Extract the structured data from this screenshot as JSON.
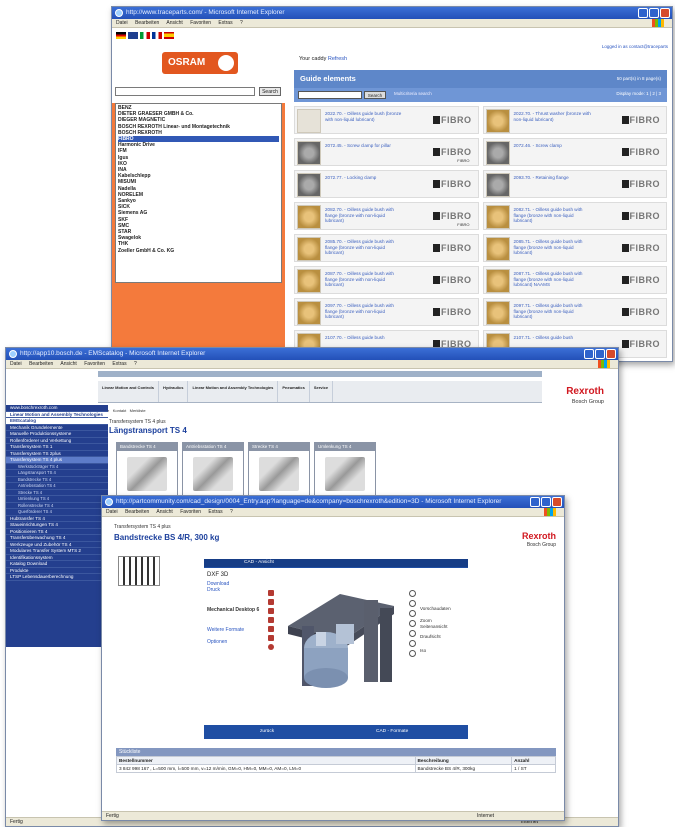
{
  "window1": {
    "title": "http://www.traceparts.com/ - Microsoft Internet Explorer",
    "menu": [
      "Datei",
      "Bearbeiten",
      "Ansicht",
      "Favoriten",
      "Extras",
      "?"
    ],
    "search_button": "Search",
    "logo_text": "OSRAM",
    "manufacturers": [
      "BENZ",
      "DIETER GRAESER GMBH & Co.",
      "DIEGER MAGNETIC",
      "BOSCH REXROTH Linear- und Montagetechnik",
      "BOSCH REXROTH",
      "FIBRO",
      "Harmonic Drive",
      "IFM",
      "Igus",
      "IKO",
      "INA",
      "Kabelschlepp",
      "MISUMI",
      "Nadella",
      "NORELEM",
      "Sankyo",
      "SICK",
      "Siemens AG",
      "SKF",
      "SMC",
      "STAR",
      "Swagelok",
      "THK",
      "Zoeller GmbH & Co. KG"
    ],
    "cart_label": "Your caddy",
    "cart_link": "Refresh",
    "login_text": "Logged in as contact@traceparts",
    "section_title": "Guide elements",
    "hits_text": "50 part(s) in 8 page(s)",
    "search_btn2": "Search",
    "advanced_link": "Multicriteria search",
    "display_text": "Display mode: 1 | 2 | 3",
    "brand_label": "FIBRO",
    "parts": [
      {
        "text": "2022.70. - Oilless guide bush (bronze with non-liquid lubricant)",
        "style": "plain",
        "note": ""
      },
      {
        "text": "2022.70. - Thrust washer (bronze with non-liquid lubricant)",
        "style": "gold",
        "note": ""
      },
      {
        "text": "2072.45. - Screw clamp for pillar",
        "style": "gray",
        "note": "FIBRO"
      },
      {
        "text": "2072.46. - Screw clamp",
        "style": "gray",
        "note": ""
      },
      {
        "text": "2072.77. - Locking clamp",
        "style": "gray",
        "note": ""
      },
      {
        "text": "2093.70. - Retaining flange",
        "style": "gray",
        "note": ""
      },
      {
        "text": "2082.70. - Oilless guide bush with flange (bronze with non-liquid lubricant)",
        "style": "gold",
        "note": "FIBRO"
      },
      {
        "text": "2082.71. - Oilless guide bush with flange (bronze with non-liquid lubricant)",
        "style": "gold",
        "note": ""
      },
      {
        "text": "2085.70. - Oilless guide bush with flange (bronze with non-liquid lubricant)",
        "style": "gold",
        "note": ""
      },
      {
        "text": "2085.71. - Oilless guide bush with flange (bronze with non-liquid lubricant)",
        "style": "gold",
        "note": ""
      },
      {
        "text": "2087.70. - Oilless guide bush with flange (bronze with non-liquid lubricant)",
        "style": "gold",
        "note": ""
      },
      {
        "text": "2087.71. - Oilless guide bush with flange (bronze with non-liquid lubricant) NAAMS",
        "style": "gold",
        "note": ""
      },
      {
        "text": "2097.70. - Oilless guide bush with flange (bronze with non-liquid lubricant)",
        "style": "gold",
        "note": ""
      },
      {
        "text": "2097.71. - Oilless guide bush with flange (bronze with non-liquid lubricant)",
        "style": "gold",
        "note": ""
      },
      {
        "text": "2107.70. - Oilless guide bush",
        "style": "gold",
        "note": ""
      },
      {
        "text": "2107.71. - Oilless guide bush",
        "style": "gold",
        "note": ""
      }
    ]
  },
  "window2": {
    "title": "http://app10.bosch.de - EMScatalog - Microsoft Internet Explorer",
    "menu": [
      "Datei",
      "Bearbeiten",
      "Ansicht",
      "Favoriten",
      "Extras",
      "?"
    ],
    "nav_tabs": [
      "Linear Motion and Controls",
      "Hydraulics",
      "Linear Motion and Assembly Technologies",
      "Pneumatics",
      "Service"
    ],
    "toolbar": [
      "Suche",
      "Kontakt",
      "Merkliste"
    ],
    "brand": "Rexroth",
    "brand_sub": "Bosch Group",
    "sidebar": [
      {
        "label": "www.boschrexroth.com",
        "style": "normal"
      },
      {
        "label": "Linear Motion and Assembly Technologies",
        "style": "hl"
      },
      {
        "label": "EMScatalog",
        "style": "hl"
      },
      {
        "label": "Mechanik Grundelemente",
        "style": "normal"
      },
      {
        "label": "Manuelle Produktionssysteme",
        "style": "normal"
      },
      {
        "label": "Rollenförderer und Verkettung",
        "style": "normal"
      },
      {
        "label": "Transfersystem TS 1",
        "style": "normal"
      },
      {
        "label": "Transfersystem TS 2plus",
        "style": "normal"
      },
      {
        "label": "Transfersystem TS 4 plus",
        "style": "act"
      },
      {
        "label": "Werkstückträger TS 4",
        "style": "sub"
      },
      {
        "label": "Längstransport TS 4",
        "style": "sub"
      },
      {
        "label": "Bandstrecke TS 4",
        "style": "sub"
      },
      {
        "label": "Antriebsstation TS 4",
        "style": "sub"
      },
      {
        "label": "Strecke TS 4",
        "style": "sub"
      },
      {
        "label": "Umlenkung TS 4",
        "style": "sub"
      },
      {
        "label": "Rollenstrecke TS 4",
        "style": "sub"
      },
      {
        "label": "Querförderer TS 4",
        "style": "sub"
      },
      {
        "label": "Hubtransfer TS 4",
        "style": "normal"
      },
      {
        "label": "Staueinrichtungen TS 4",
        "style": "normal"
      },
      {
        "label": "Positionieren TS 4",
        "style": "normal"
      },
      {
        "label": "Transferüberwachung TS 4",
        "style": "normal"
      },
      {
        "label": "Werkzeuge und Zubehör TS 4",
        "style": "normal"
      },
      {
        "label": "Modulares Transfer System MTS 2",
        "style": "normal"
      },
      {
        "label": "Identifikationssystem",
        "style": "normal"
      },
      {
        "label": "Katalog Download",
        "style": "normal"
      },
      {
        "label": "Produkte",
        "style": "normal"
      },
      {
        "label": "LTSP Lebensdauerberechnung",
        "style": "normal"
      }
    ],
    "breadcrumb": "Transfersystem TS 4 plus",
    "page_title": "Längstransport TS 4",
    "categories": [
      "Bandstrecke TS 4",
      "Antriebsstation TS 4",
      "Strecke TS 4",
      "Umlenkung TS 4"
    ],
    "status": "Fertig",
    "status_zone": "Internet"
  },
  "window3": {
    "title": "http://partcommunity.com/cad_design/0004_Entry.asp?language=de&company=boschrexroth&edition=3D - Microsoft Internet Explorer",
    "menu": [
      "Datei",
      "Bearbeiten",
      "Ansicht",
      "Favoriten",
      "Extras",
      "?"
    ],
    "breadcrumb": "Transfersystem TS 4 plus",
    "page_title": "Bandstrecke BS 4/R, 300 kg",
    "brand": "Rexroth",
    "brand_sub": "Bosch Group",
    "cad_title": "CAD - Ansicht",
    "cad_left": {
      "format": "DXF 3D",
      "download": "Download",
      "print": "Druck",
      "mech": "Mechanical Desktop 6",
      "more": "Weitere Formate",
      "options": "Optionen"
    },
    "cad_right": [
      "Vorschaudaten",
      "Zoom",
      "Seitenansicht",
      "Draufsicht",
      "Iso"
    ],
    "cad_footer_left": "zurück",
    "cad_footer_right": "CAD - Formate",
    "stueckliste_title": "Stückliste",
    "table_headers": [
      "Bestellnummer",
      "Beschreibung",
      "Anzahl"
    ],
    "table_rows": [
      [
        "3 842 998 167 , L=500 mm, l=500 mm, v=12 m/min, GM=0, HM=0, MM=0, AM=0, LM=0",
        "Bandstrecke BS 4/R, 300kg",
        "1 / ST"
      ]
    ],
    "status": "Fertig",
    "status_zone": "Internet"
  }
}
